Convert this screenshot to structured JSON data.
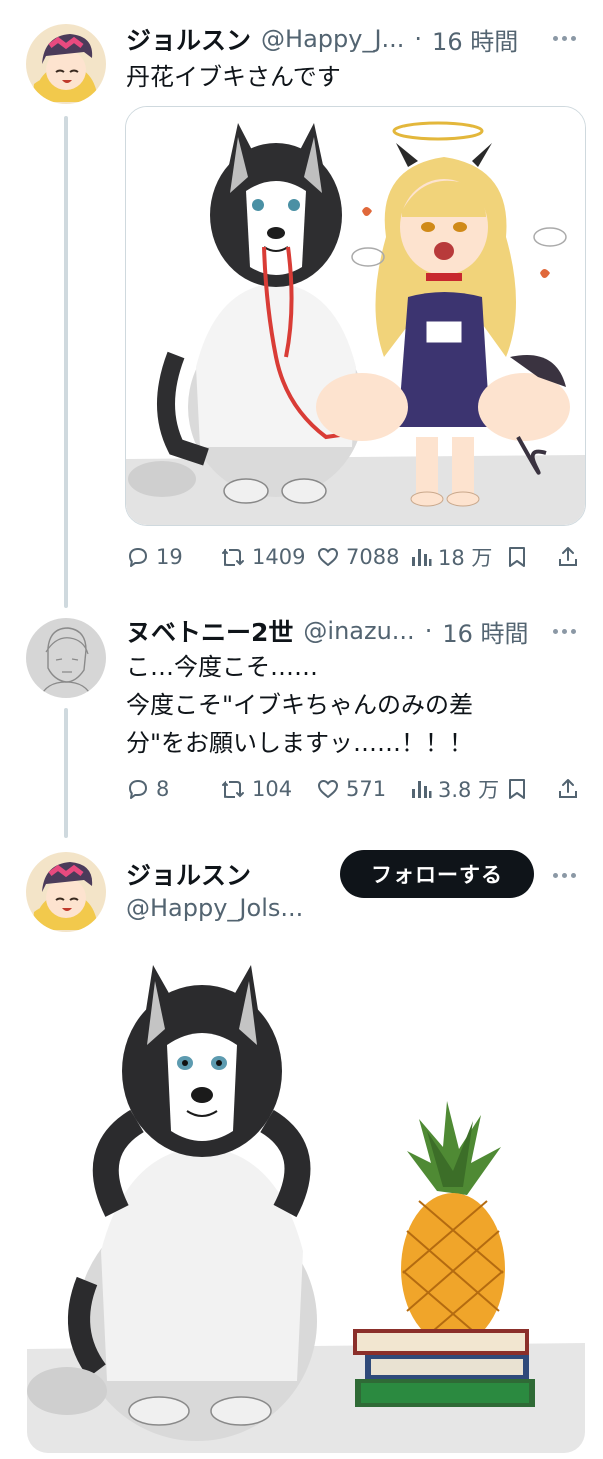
{
  "tweet1": {
    "display_name": "ジョルスン",
    "handle": "@Happy_J...",
    "separator": "·",
    "time": "16 時間",
    "text": "丹花イブキさんです",
    "stats": {
      "replies": "19",
      "retweets": "1409",
      "likes": "7088",
      "views": "18 万"
    }
  },
  "tweet2": {
    "display_name": "ヌベトニー2世",
    "handle": "@inazu...",
    "separator": "·",
    "time": "16 時間",
    "text_lines": [
      "こ…今度こそ……",
      "今度こそ\"イブキちゃんのみの差",
      "分\"をお願いしますッ……！！！"
    ],
    "stats": {
      "replies": "8",
      "retweets": "104",
      "likes": "571",
      "views": "3.8 万"
    }
  },
  "tweet3": {
    "display_name": "ジョルスン",
    "handle": "@Happy_Jols...",
    "follow_label": "フォローする"
  },
  "icons": [
    "more-icon",
    "reply-icon",
    "retweet-icon",
    "like-icon",
    "views-icon",
    "bookmark-icon",
    "share-icon"
  ],
  "colors": {
    "text": "#0f1419",
    "muted": "#536471",
    "border": "#cfd9de",
    "button_bg": "#0f1419"
  }
}
